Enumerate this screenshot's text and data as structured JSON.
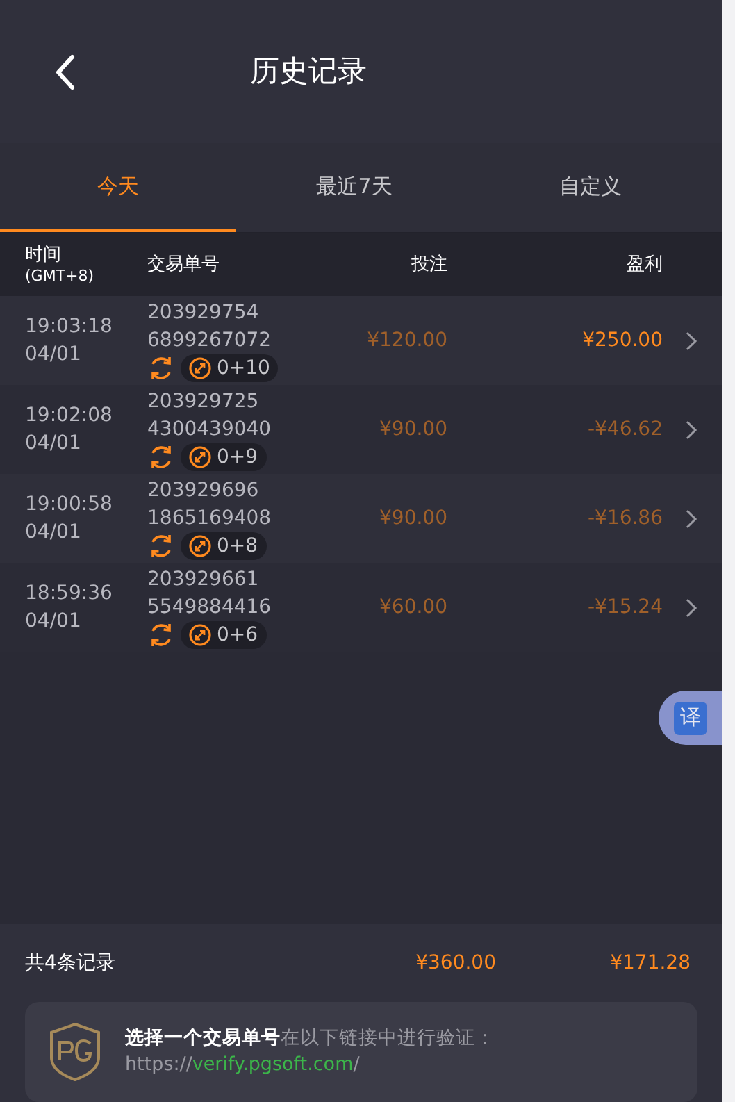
{
  "header": {
    "title": "历史记录"
  },
  "tabs": [
    {
      "label": "今天",
      "selected": true
    },
    {
      "label": "最近7天",
      "selected": false
    },
    {
      "label": "自定义",
      "selected": false
    }
  ],
  "table": {
    "columns": [
      {
        "label": "时间",
        "sub": "(GMT+8)"
      },
      {
        "label": "交易单号"
      },
      {
        "label": "投注"
      },
      {
        "label": "盈利"
      }
    ],
    "rows": [
      {
        "time": "19:03:18",
        "date": "04/01",
        "id_line_1": "203929754",
        "id_line_2": "6899267072",
        "spins": "0+10",
        "bet": "¥120.00",
        "profit": "¥250.00",
        "kind": "win"
      },
      {
        "time": "19:02:08",
        "date": "04/01",
        "id_line_1": "203929725",
        "id_line_2": "4300439040",
        "spins": "0+9",
        "bet": "¥90.00",
        "profit": "-¥46.62",
        "kind": "loss"
      },
      {
        "time": "19:00:58",
        "date": "04/01",
        "id_line_1": "203929696",
        "id_line_2": "1865169408",
        "spins": "0+8",
        "bet": "¥90.00",
        "profit": "-¥16.86",
        "kind": "loss"
      },
      {
        "time": "18:59:36",
        "date": "04/01",
        "id_line_1": "203929661",
        "id_line_2": "5549884416",
        "spins": "0+6",
        "bet": "¥60.00",
        "profit": "-¥15.24",
        "kind": "loss"
      }
    ]
  },
  "summary": {
    "count": "共4条记录",
    "total_bet": "¥360.00",
    "total_profit": "¥171.28"
  },
  "verify": {
    "text": "**选择一个交易单号**在以下链接中进行验证：",
    "link_prefix": "https://",
    "link": "verify.pgsoft.com",
    "link_suffix": "/"
  },
  "translate_button": {
    "label": "译"
  }
}
